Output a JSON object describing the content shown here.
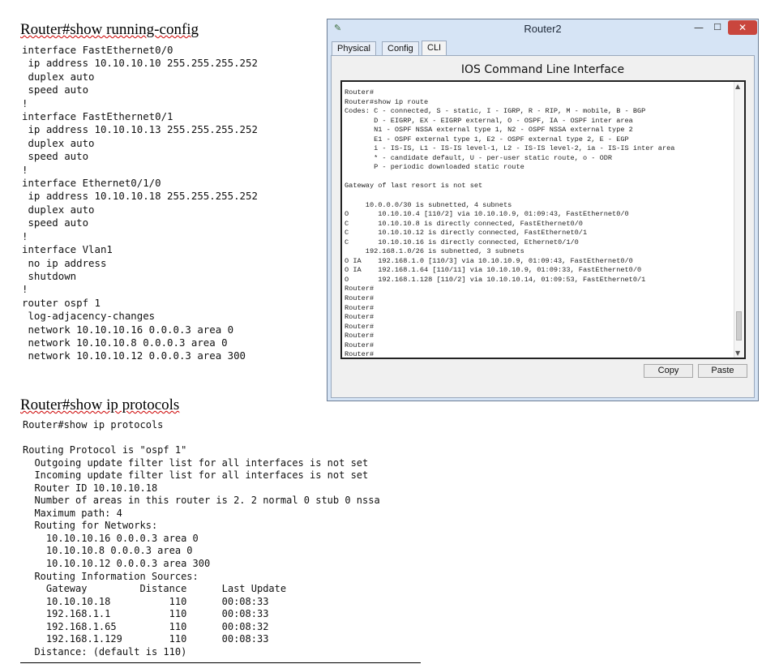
{
  "running_config": {
    "heading": "Router#show running-config",
    "text": "interface FastEthernet0/0\n ip address 10.10.10.10 255.255.255.252\n duplex auto\n speed auto\n!\ninterface FastEthernet0/1\n ip address 10.10.10.13 255.255.255.252\n duplex auto\n speed auto\n!\ninterface Ethernet0/1/0\n ip address 10.10.10.18 255.255.255.252\n duplex auto\n speed auto\n!\ninterface Vlan1\n no ip address\n shutdown\n!\nrouter ospf 1\n log-adjacency-changes\n network 10.10.10.16 0.0.0.3 area 0\n network 10.10.10.8 0.0.0.3 area 0\n network 10.10.10.12 0.0.0.3 area 300"
  },
  "ip_protocols": {
    "heading": "Router#show ip protocols",
    "text": "Router#show ip protocols\n\nRouting Protocol is \"ospf 1\"\n  Outgoing update filter list for all interfaces is not set\n  Incoming update filter list for all interfaces is not set\n  Router ID 10.10.10.18\n  Number of areas in this router is 2. 2 normal 0 stub 0 nssa\n  Maximum path: 4\n  Routing for Networks:\n    10.10.10.16 0.0.0.3 area 0\n    10.10.10.8 0.0.0.3 area 0\n    10.10.10.12 0.0.0.3 area 300\n  Routing Information Sources:\n    Gateway         Distance      Last Update\n    10.10.10.18          110      00:08:33\n    192.168.1.1          110      00:08:33\n    192.168.1.65         110      00:08:32\n    192.168.1.129        110      00:08:33\n  Distance: (default is 110)"
  },
  "window": {
    "title": "Router2",
    "minimize_glyph": "—",
    "maximize_glyph": "☐",
    "close_glyph": "✕",
    "tabs": [
      "Physical",
      "Config",
      "CLI"
    ],
    "active_tab": "CLI",
    "panel_title": "IOS Command Line Interface",
    "terminal_text": "Router#\nRouter#show ip route\nCodes: C - connected, S - static, I - IGRP, R - RIP, M - mobile, B - BGP\n       D - EIGRP, EX - EIGRP external, O - OSPF, IA - OSPF inter area\n       N1 - OSPF NSSA external type 1, N2 - OSPF NSSA external type 2\n       E1 - OSPF external type 1, E2 - OSPF external type 2, E - EGP\n       i - IS-IS, L1 - IS-IS level-1, L2 - IS-IS level-2, ia - IS-IS inter area\n       * - candidate default, U - per-user static route, o - ODR\n       P - periodic downloaded static route\n\nGateway of last resort is not set\n\n     10.0.0.0/30 is subnetted, 4 subnets\nO       10.10.10.4 [110/2] via 10.10.10.9, 01:09:43, FastEthernet0/0\nC       10.10.10.8 is directly connected, FastEthernet0/0\nC       10.10.10.12 is directly connected, FastEthernet0/1\nC       10.10.10.16 is directly connected, Ethernet0/1/0\n     192.168.1.0/26 is subnetted, 3 subnets\nO IA    192.168.1.0 [110/3] via 10.10.10.9, 01:09:43, FastEthernet0/0\nO IA    192.168.1.64 [110/11] via 10.10.10.9, 01:09:33, FastEthernet0/0\nO       192.168.1.128 [110/2] via 10.10.10.14, 01:09:53, FastEthernet0/1\nRouter#\nRouter#\nRouter#\nRouter#\nRouter#\nRouter#\nRouter#\nRouter#",
    "copy_label": "Copy",
    "paste_label": "Paste"
  },
  "colors": {
    "window_frame": "#d6e4f5",
    "close_button": "#c9463d",
    "terminal_background": "#ffffff"
  }
}
